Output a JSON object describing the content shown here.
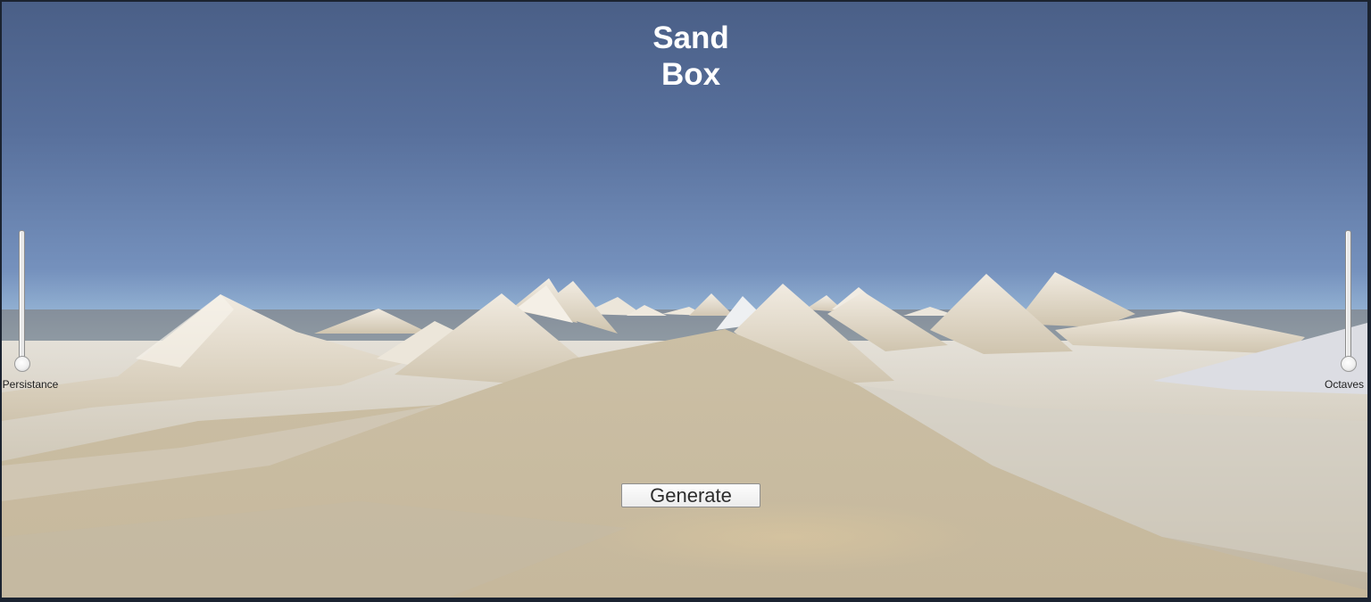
{
  "title": {
    "line1": "Sand",
    "line2": "Box"
  },
  "sliders": {
    "persistance": {
      "label": "Persistance",
      "value_fraction": 0.0
    },
    "octaves": {
      "label": "Octaves",
      "value_fraction": 0.0
    }
  },
  "generate_button": {
    "label": "Generate"
  },
  "colors": {
    "sky_top": "#4a5f87",
    "sky_horizon": "#d9f6fb",
    "sand": "#d8cdb9",
    "title_text": "#ffffff"
  }
}
